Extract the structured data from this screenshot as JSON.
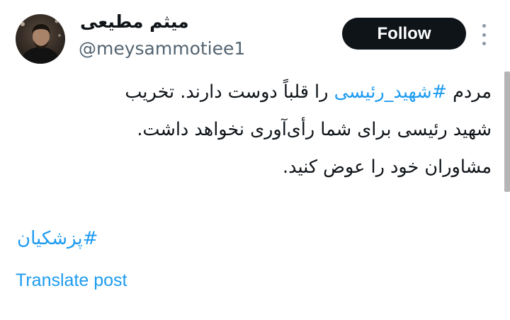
{
  "author": {
    "display_name": "میثم مطیعی",
    "handle": "@meysammotiee1",
    "avatar_icon": "profile-photo"
  },
  "header": {
    "follow_label": "Follow",
    "more_icon": "more-vertical-icon"
  },
  "tweet": {
    "line1_prefix": "مردم ",
    "line1_hashtag": "#شهید_رئیسی",
    "line1_suffix": " را قلباً دوست دارند. تخریب",
    "line2": "شهید رئیسی برای شما رأی‌آوری نخواهد داشت.",
    "line3": "مشاوران خود را عوض کنید.",
    "hashtag2": "#پزشکیان"
  },
  "footer": {
    "translate_label": "Translate post"
  },
  "colors": {
    "link": "#1d9bf0",
    "text": "#0f1419",
    "secondary": "#536471",
    "button_bg": "#0f1419"
  }
}
